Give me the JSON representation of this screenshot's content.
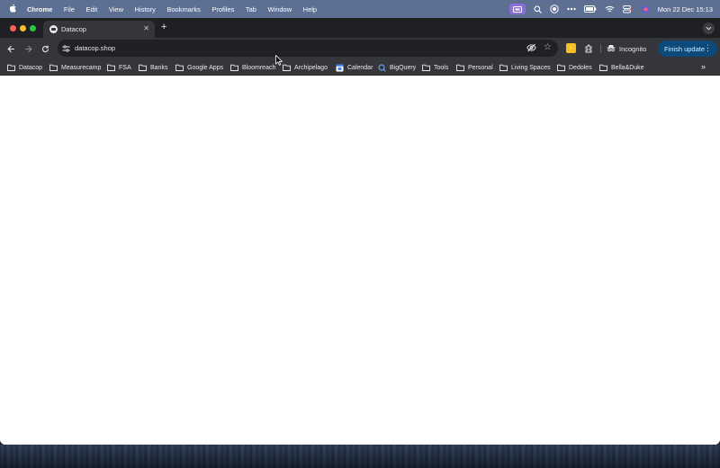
{
  "os_menubar": {
    "items": [
      "Chrome",
      "File",
      "Edit",
      "View",
      "History",
      "Bookmarks",
      "Profiles",
      "Tab",
      "Window",
      "Help"
    ],
    "clock": "Mon 22 Dec  15:13"
  },
  "browser": {
    "tab": {
      "title": "Datacop"
    },
    "address": {
      "url": "datacop.shop"
    },
    "toolbar": {
      "incognito_label": "Incognito",
      "finish_update_label": "Finish update"
    },
    "bookmarks": [
      {
        "label": "Datacop",
        "icon": "folder-icon"
      },
      {
        "label": "Measurecamp",
        "icon": "folder-icon"
      },
      {
        "label": "FSA",
        "icon": "folder-icon"
      },
      {
        "label": "Banks",
        "icon": "folder-icon"
      },
      {
        "label": "Google Apps",
        "icon": "folder-icon"
      },
      {
        "label": "Bloomreach",
        "icon": "folder-icon"
      },
      {
        "label": "Archipelago",
        "icon": "folder-icon"
      },
      {
        "label": "Calendar",
        "icon": "calendar-icon"
      },
      {
        "label": "BigQuery",
        "icon": "bigquery-icon"
      },
      {
        "label": "Tools",
        "icon": "folder-icon"
      },
      {
        "label": "Personal",
        "icon": "folder-icon"
      },
      {
        "label": "Living Spaces",
        "icon": "folder-icon"
      },
      {
        "label": "Dedoles",
        "icon": "folder-icon"
      },
      {
        "label": "Bella&Duke",
        "icon": "folder-icon"
      }
    ]
  },
  "colors": {
    "menubar": "#5d6f92",
    "tabstrip": "#1f2023",
    "toolbar": "#35363a",
    "finish_update": "#0b4a7a",
    "extension": "#f2c026"
  }
}
